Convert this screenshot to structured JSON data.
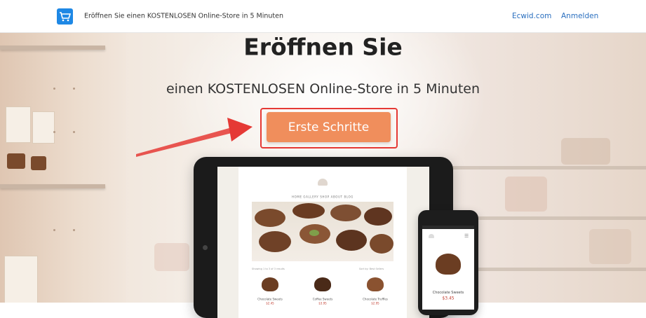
{
  "header": {
    "logo_icon": "shopping-cart-icon",
    "brand_text": "Eröffnen Sie einen KOSTENLOSEN Online-Store in 5 Minuten",
    "nav_ecwid": "Ecwid.com",
    "nav_login": "Anmelden"
  },
  "hero": {
    "title": "Eröffnen Sie",
    "subtitle": "einen KOSTENLOSEN Online-Store in 5 Minuten",
    "cta_label": "Erste Schritte"
  },
  "tablet_site": {
    "nav": "HOME   GALLERY   SHOP   ABOUT   BLOG",
    "caption_left": "Showing 1 to 3 of 3 results",
    "caption_right": "Sort by: Best Sellers",
    "products": [
      {
        "name": "Chocolate Sweets",
        "price": "$2.45"
      },
      {
        "name": "Coffee Sweets",
        "price": "$3.95"
      },
      {
        "name": "Chocolate Truffles",
        "price": "$2.95"
      }
    ]
  },
  "phone_site": {
    "product_name": "Chocolate Sweets",
    "product_price": "$3.45"
  },
  "colors": {
    "accent_blue": "#1e88e5",
    "link_blue": "#2a6fbf",
    "cta_orange": "#f08e5c",
    "highlight_red": "#e53935"
  }
}
